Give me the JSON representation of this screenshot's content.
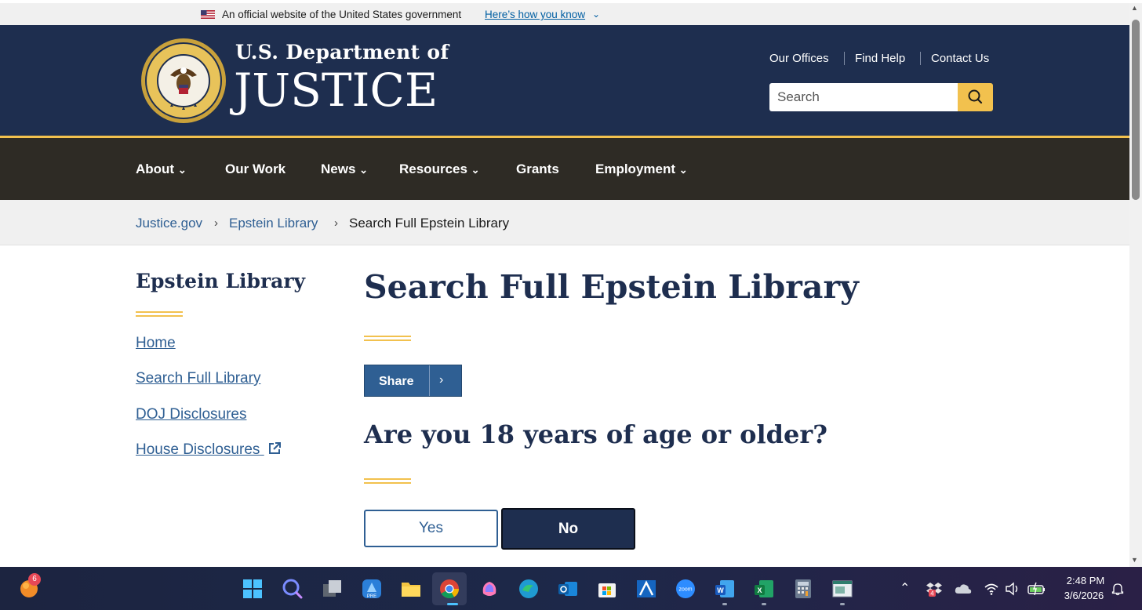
{
  "gov_banner": {
    "text": "An official website of the United States government",
    "link": "Here’s how you know"
  },
  "brand": {
    "line1": "U.S. Department of",
    "line2": "JUSTICE"
  },
  "utility_nav": [
    "Our Offices",
    "Find Help",
    "Contact Us"
  ],
  "search": {
    "placeholder": "Search"
  },
  "main_nav": [
    {
      "label": "About"
    },
    {
      "label": "Our Work"
    },
    {
      "label": "News"
    },
    {
      "label": "Resources"
    },
    {
      "label": "Grants"
    },
    {
      "label": "Employment"
    }
  ],
  "breadcrumb": [
    "Justice.gov",
    "Epstein Library",
    "Search Full Epstein Library"
  ],
  "sidebar": {
    "title": "Epstein Library",
    "links": [
      "Home",
      "Search Full Library",
      "DOJ Disclosures",
      "House Disclosures"
    ]
  },
  "main": {
    "title": "Search Full Epstein Library",
    "share_label": "Share",
    "question": "Are you 18 years of age or older?",
    "yes_label": "Yes",
    "no_label": "No"
  },
  "taskbar": {
    "notification_badge": "6",
    "time": "2:48 PM",
    "date": "3/6/2026",
    "apps": [
      "windows-start",
      "search",
      "task-view",
      "copilot-pre",
      "file-explorer",
      "chrome",
      "copilot",
      "edge",
      "outlook",
      "microsoft-store",
      "app-a",
      "zoom",
      "word",
      "excel",
      "calculator",
      "app-window"
    ]
  },
  "colors": {
    "navy": "#1e2e4f",
    "gold": "#f2c14e",
    "nav_dark": "#2e2b25",
    "link_blue": "#2f5f93"
  }
}
